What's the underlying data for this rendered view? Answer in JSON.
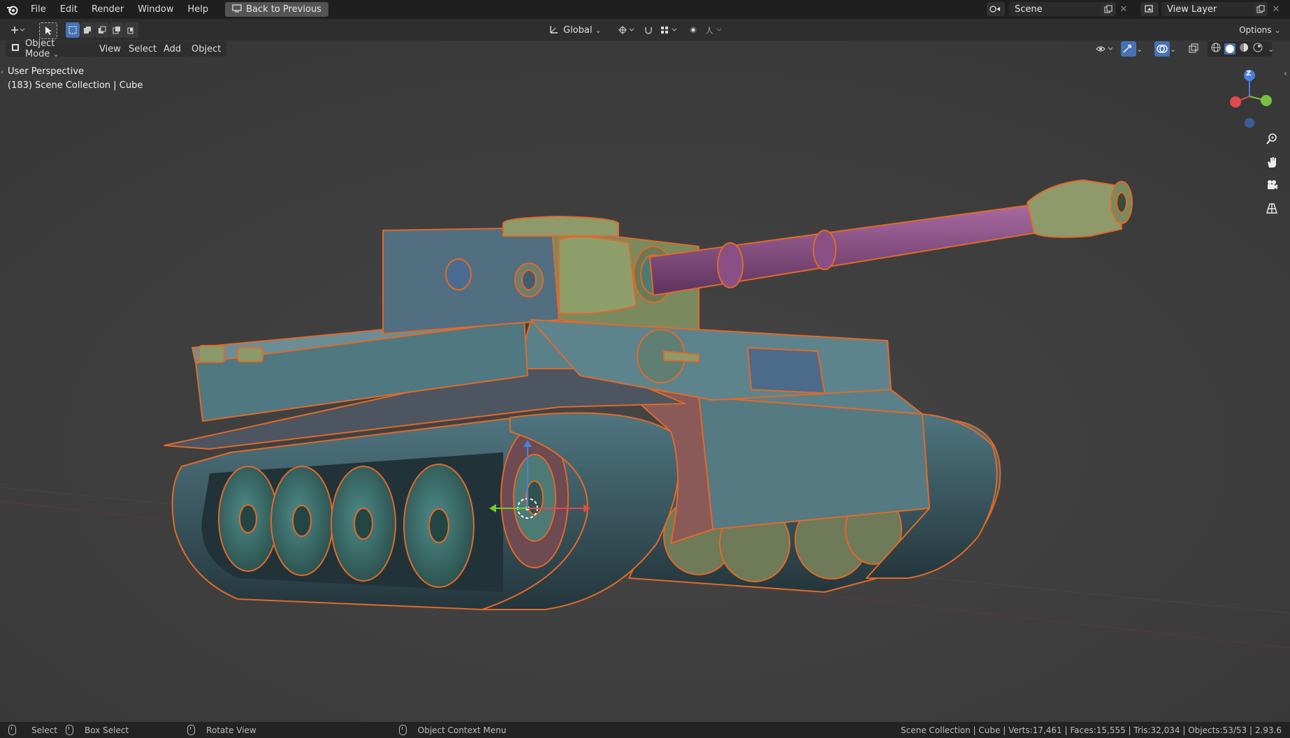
{
  "topbar": {
    "menus": [
      "File",
      "Edit",
      "Render",
      "Window",
      "Help"
    ],
    "back_button": "Back to Previous",
    "scene_label": "Scene",
    "view_layer_label": "View Layer"
  },
  "toolbar": {
    "transform_orientation": "Global",
    "options_label": "Options"
  },
  "header": {
    "mode_label": "Object Mode",
    "menus": [
      "View",
      "Select",
      "Add",
      "Object"
    ]
  },
  "viewport": {
    "perspective_label": "User Perspective",
    "collection_label": "(183) Scene Collection | Cube",
    "gizmo_axes": {
      "z": "Z"
    }
  },
  "statusbar": {
    "select": "Select",
    "box_select": "Box Select",
    "rotate_view": "Rotate View",
    "context_menu": "Object Context Menu",
    "stats": "Scene Collection | Cube | Verts:17,461 | Faces:15,555 | Tris:32,034 | Objects:53/53 | 2.93.6"
  },
  "colors": {
    "selection_outline": "#e06a2a",
    "hull": "#4c6f78",
    "barrel": "#8a4f85",
    "turret_parts": "#8a9a6a"
  }
}
